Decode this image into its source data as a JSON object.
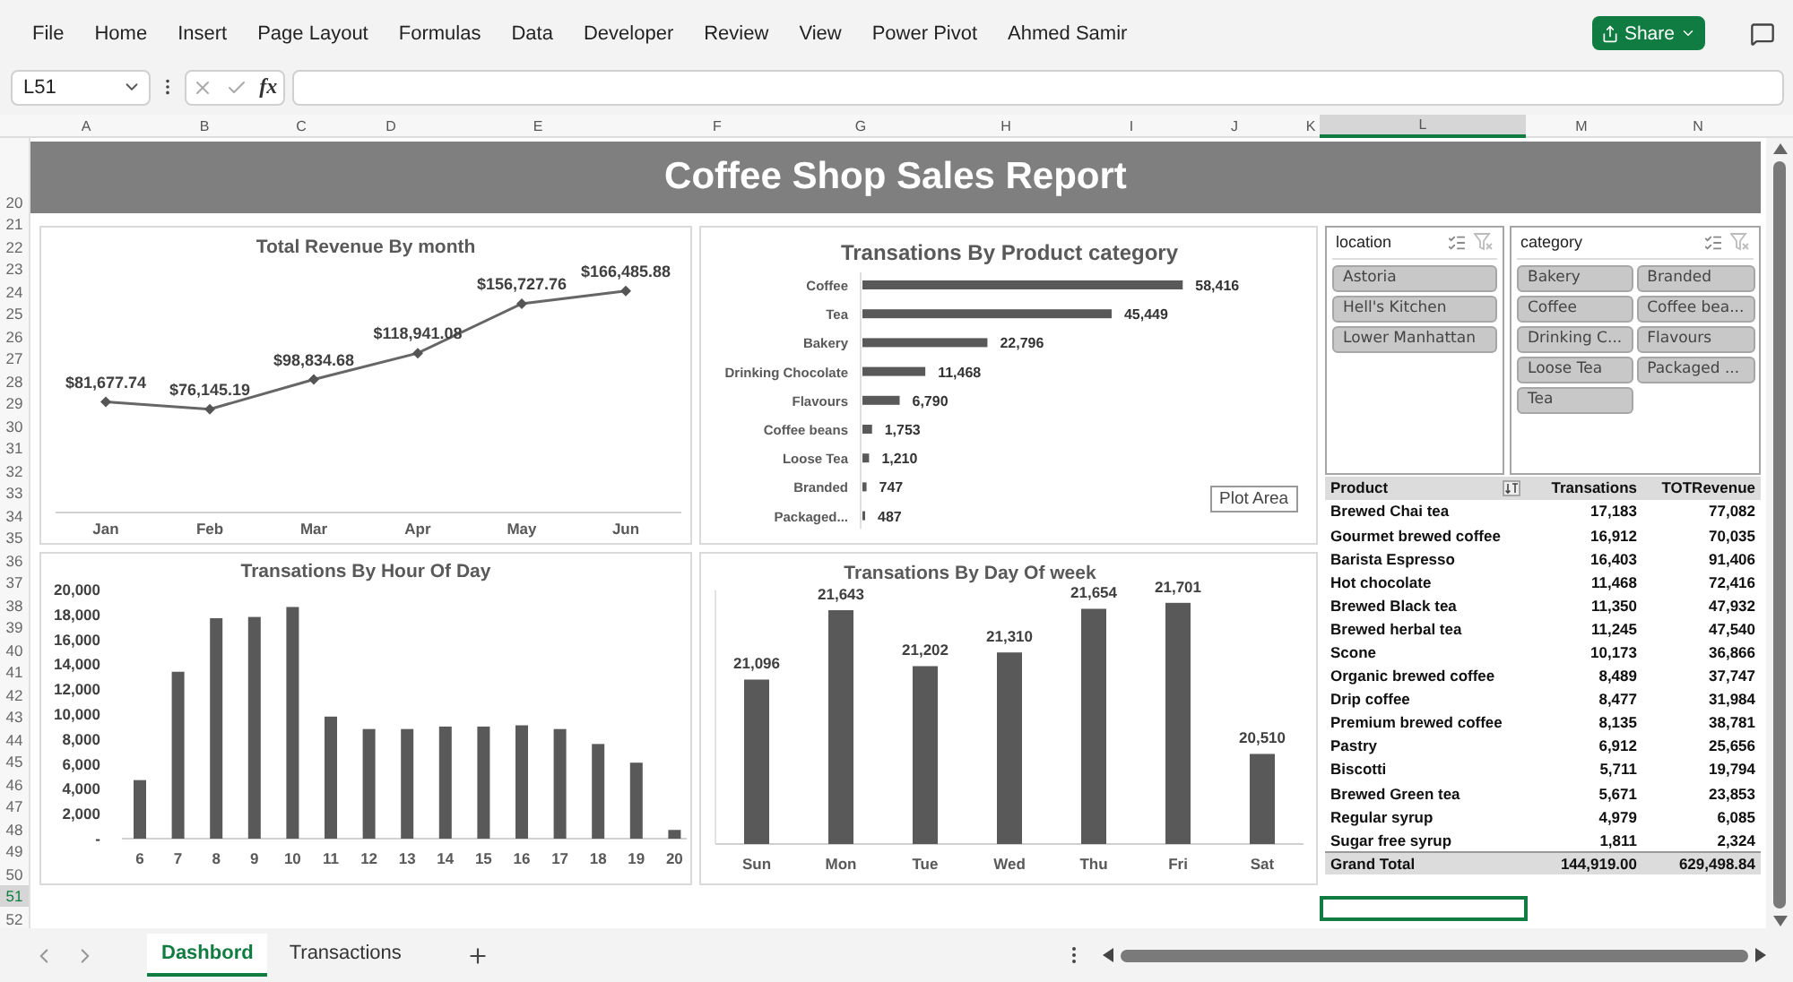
{
  "menu": {
    "items": [
      "File",
      "Home",
      "Insert",
      "Page Layout",
      "Formulas",
      "Data",
      "Developer",
      "Review",
      "View",
      "Power Pivot",
      "Ahmed Samir"
    ],
    "share_button": "Share"
  },
  "formula_bar": {
    "name_box": "L51",
    "fx": "fx"
  },
  "columns": [
    {
      "label": "A",
      "selected": false
    },
    {
      "label": "B",
      "selected": false
    },
    {
      "label": "C",
      "selected": false
    },
    {
      "label": "D",
      "selected": false
    },
    {
      "label": "E",
      "selected": false
    },
    {
      "label": "F",
      "selected": false
    },
    {
      "label": "G",
      "selected": false
    },
    {
      "label": "H",
      "selected": false
    },
    {
      "label": "I",
      "selected": false
    },
    {
      "label": "J",
      "selected": false
    },
    {
      "label": "K",
      "selected": false
    },
    {
      "label": "L",
      "selected": true
    },
    {
      "label": "M",
      "selected": false
    },
    {
      "label": "N",
      "selected": false
    }
  ],
  "rows": [
    {
      "label": "20",
      "selected": false
    },
    {
      "label": "21",
      "selected": false
    },
    {
      "label": "22",
      "selected": false
    },
    {
      "label": "23",
      "selected": false
    },
    {
      "label": "24",
      "selected": false
    },
    {
      "label": "25",
      "selected": false
    },
    {
      "label": "26",
      "selected": false
    },
    {
      "label": "27",
      "selected": false
    },
    {
      "label": "28",
      "selected": false
    },
    {
      "label": "29",
      "selected": false
    },
    {
      "label": "30",
      "selected": false
    },
    {
      "label": "31",
      "selected": false
    },
    {
      "label": "32",
      "selected": false
    },
    {
      "label": "33",
      "selected": false
    },
    {
      "label": "34",
      "selected": false
    },
    {
      "label": "35",
      "selected": false
    },
    {
      "label": "36",
      "selected": false
    },
    {
      "label": "37",
      "selected": false
    },
    {
      "label": "38",
      "selected": false
    },
    {
      "label": "39",
      "selected": false
    },
    {
      "label": "40",
      "selected": false
    },
    {
      "label": "41",
      "selected": false
    },
    {
      "label": "42",
      "selected": false
    },
    {
      "label": "43",
      "selected": false
    },
    {
      "label": "44",
      "selected": false
    },
    {
      "label": "45",
      "selected": false
    },
    {
      "label": "46",
      "selected": false
    },
    {
      "label": "47",
      "selected": false
    },
    {
      "label": "48",
      "selected": false
    },
    {
      "label": "49",
      "selected": false
    },
    {
      "label": "50",
      "selected": false
    },
    {
      "label": "51",
      "selected": true
    },
    {
      "label": "52",
      "selected": false
    }
  ],
  "title": "Coffee Shop Sales Report",
  "revenue_chart": {
    "chart_data": {
      "type": "line",
      "title": "Total Revenue By month",
      "categories": [
        "Jan",
        "Feb",
        "Mar",
        "Apr",
        "May",
        "Jun"
      ],
      "values": [
        81677.74,
        76145.19,
        98834.68,
        118941.08,
        156727.76,
        166485.88
      ],
      "marker": "diamond",
      "value_labels": [
        "$81,677.74",
        "$76,145.19",
        "$98,834.68",
        "$118,941.08",
        "$156,727.76",
        "$166,485.88"
      ]
    }
  },
  "category_chart": {
    "chart_data": {
      "type": "bar",
      "orientation": "horizontal",
      "title": "Transations By Product category",
      "categories": [
        "Coffee",
        "Tea",
        "Bakery",
        "Drinking Chocolate",
        "Flavours",
        "Coffee beans",
        "Loose Tea",
        "Branded",
        "Packaged..."
      ],
      "values": [
        58416,
        45449,
        22796,
        11468,
        6790,
        1753,
        1210,
        747,
        487
      ],
      "value_labels": [
        "58,416",
        "45,449",
        "22,796",
        "11,468",
        "6,790",
        "1,753",
        "1,210",
        "747",
        "487"
      ]
    }
  },
  "slicers": [
    {
      "title": "location",
      "items": [
        {
          "label": "Astoria",
          "selected": true
        },
        {
          "label": "Hell's Kitchen",
          "selected": true
        },
        {
          "label": "Lower Manhattan",
          "selected": true
        }
      ]
    },
    {
      "title": "category",
      "items": [
        {
          "label": "Bakery",
          "selected": true
        },
        {
          "label": "Branded",
          "selected": true
        },
        {
          "label": "Coffee",
          "selected": true
        },
        {
          "label": "Coffee bea...",
          "selected": true
        },
        {
          "label": "Drinking C...",
          "selected": true
        },
        {
          "label": "Flavours",
          "selected": true
        },
        {
          "label": "Loose Tea",
          "selected": true
        },
        {
          "label": "Packaged ...",
          "selected": true
        },
        {
          "label": "Tea",
          "selected": true
        }
      ]
    }
  ],
  "tooltip": "Plot Area",
  "hour_chart": {
    "chart_data": {
      "type": "bar",
      "title": "Transations By Hour Of Day",
      "categories": [
        "6",
        "7",
        "8",
        "9",
        "10",
        "11",
        "12",
        "13",
        "14",
        "15",
        "16",
        "17",
        "18",
        "19",
        "20"
      ],
      "values": [
        4700,
        13400,
        17700,
        17800,
        18600,
        9800,
        8800,
        8800,
        9000,
        9000,
        9100,
        8800,
        7600,
        6100,
        700
      ],
      "ylim": [
        0,
        20000
      ],
      "yticks": [
        {
          "value": 0,
          "label": "-"
        },
        {
          "value": 2000,
          "label": "2,000"
        },
        {
          "value": 4000,
          "label": "4,000"
        },
        {
          "value": 6000,
          "label": "6,000"
        },
        {
          "value": 8000,
          "label": "8,000"
        },
        {
          "value": 10000,
          "label": "10,000"
        },
        {
          "value": 12000,
          "label": "12,000"
        },
        {
          "value": 14000,
          "label": "14,000"
        },
        {
          "value": 16000,
          "label": "16,000"
        },
        {
          "value": 18000,
          "label": "18,000"
        },
        {
          "value": 20000,
          "label": "20,000"
        }
      ]
    }
  },
  "day_chart": {
    "chart_data": {
      "type": "bar",
      "title": "Transations By Day Of week",
      "categories": [
        "Sun",
        "Mon",
        "Tue",
        "Wed",
        "Thu",
        "Fri",
        "Sat"
      ],
      "values": [
        21096,
        21643,
        21202,
        21310,
        21654,
        21701,
        20510
      ],
      "ylim": [
        19800,
        21800
      ],
      "value_labels": [
        "21,096",
        "21,643",
        "21,202",
        "21,310",
        "21,654",
        "21,701",
        "20,510"
      ]
    }
  },
  "pivot": {
    "columns": [
      "Product",
      "Transations",
      "TOTRevenue"
    ],
    "rows": [
      [
        "Brewed Chai tea",
        "17,183",
        "77,082"
      ],
      [
        "Gourmet brewed coffee",
        "16,912",
        "70,035"
      ],
      [
        "Barista Espresso",
        "16,403",
        "91,406"
      ],
      [
        "Hot chocolate",
        "11,468",
        "72,416"
      ],
      [
        "Brewed Black tea",
        "11,350",
        "47,932"
      ],
      [
        "Brewed herbal tea",
        "11,245",
        "47,540"
      ],
      [
        "Scone",
        "10,173",
        "36,866"
      ],
      [
        "Organic brewed coffee",
        "8,489",
        "37,747"
      ],
      [
        "Drip coffee",
        "8,477",
        "31,984"
      ],
      [
        "Premium brewed coffee",
        "8,135",
        "38,781"
      ],
      [
        "Pastry",
        "6,912",
        "25,656"
      ],
      [
        "Biscotti",
        "5,711",
        "19,794"
      ],
      [
        "Brewed Green tea",
        "5,671",
        "23,853"
      ],
      [
        "Regular syrup",
        "4,979",
        "6,085"
      ],
      [
        "Sugar free syrup",
        "1,811",
        "2,324"
      ]
    ],
    "total": [
      "Grand Total",
      "144,919.00",
      "629,498.84"
    ]
  },
  "sheet_tabs": [
    {
      "label": "Dashbord",
      "selected": true
    },
    {
      "label": "Transactions",
      "selected": false
    }
  ]
}
